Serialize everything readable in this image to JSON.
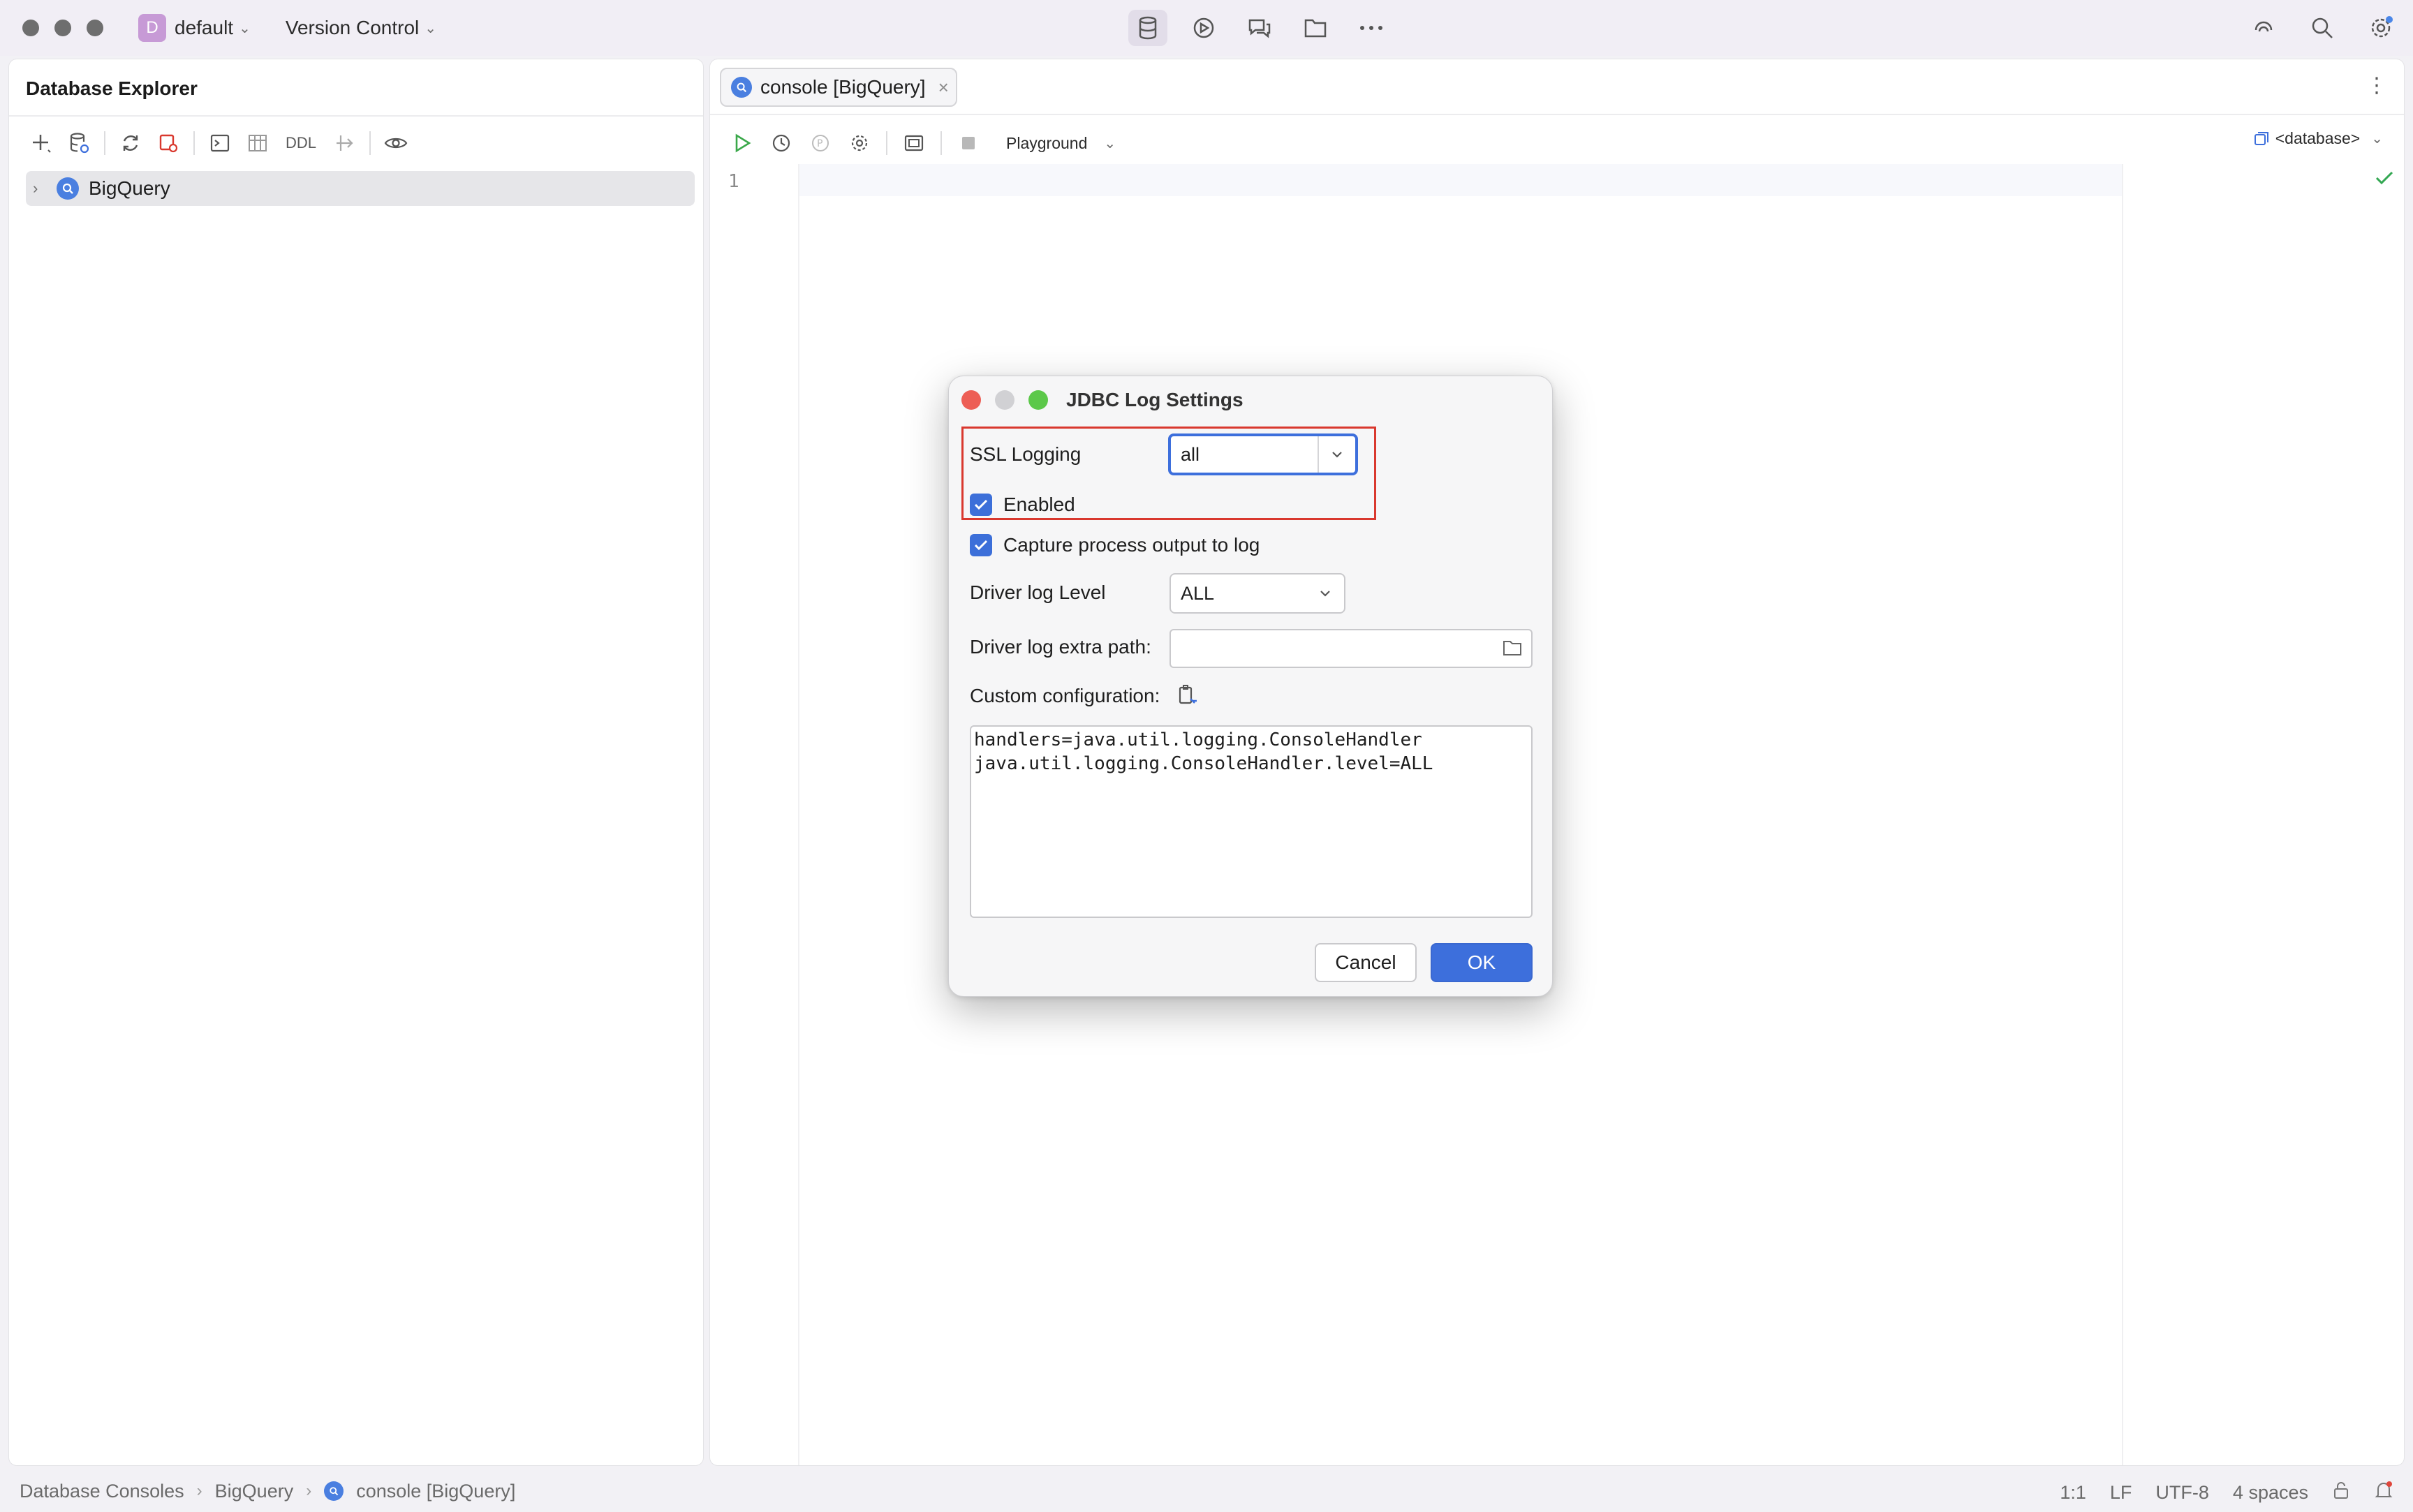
{
  "titlebar": {
    "project_initial": "D",
    "project_name": "default",
    "vcs_label": "Version Control"
  },
  "explorer": {
    "title": "Database Explorer",
    "toolbar_ddl": "DDL",
    "tree": [
      {
        "label": "BigQuery",
        "expanded": false,
        "selected": true
      }
    ]
  },
  "editor": {
    "tab_label": "console [BigQuery]",
    "mode_label": "Playground",
    "database_label": "<database>",
    "line_number": "1"
  },
  "statusbar": {
    "crumbs": [
      "Database Consoles",
      "BigQuery",
      "console [BigQuery]"
    ],
    "position": "1:1",
    "line_ending": "LF",
    "encoding": "UTF-8",
    "indent": "4 spaces"
  },
  "dialog": {
    "title": "JDBC Log Settings",
    "ssl_label": "SSL Logging",
    "ssl_value": "all",
    "enabled_label": "Enabled",
    "enabled_checked": true,
    "capture_label": "Capture process output to log",
    "capture_checked": true,
    "driver_level_label": "Driver log Level",
    "driver_level_value": "ALL",
    "driver_path_label": "Driver log extra path:",
    "driver_path_value": "",
    "custom_config_label": "Custom configuration:",
    "custom_config_text": "handlers=java.util.logging.ConsoleHandler\njava.util.logging.ConsoleHandler.level=ALL",
    "cancel_label": "Cancel",
    "ok_label": "OK"
  },
  "colors": {
    "accent": "#3d6fdc",
    "highlight_border": "#d9382e",
    "close_red": "#ed5e55",
    "maximize_green": "#5cc84a",
    "ok_green_check": "#34a853"
  }
}
